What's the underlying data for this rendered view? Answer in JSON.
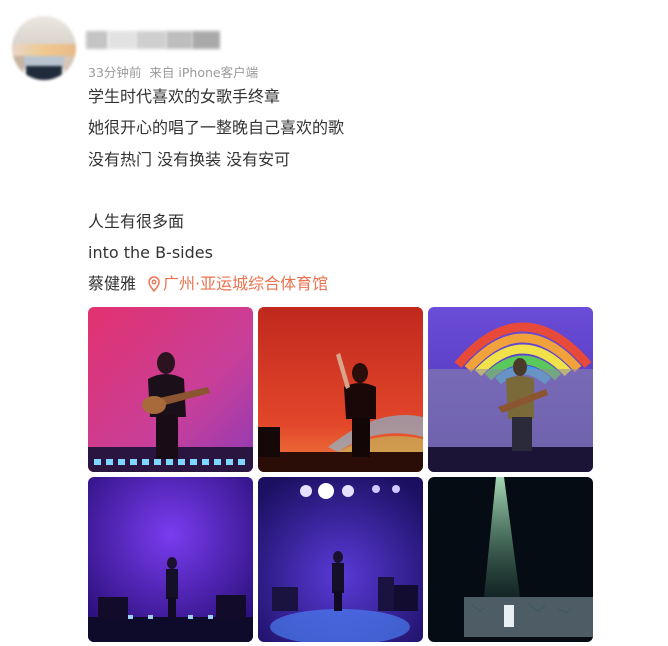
{
  "post": {
    "time": "33分钟前",
    "source": "来自 iPhone客户端",
    "lines": [
      "学生时代喜欢的女歌手终章",
      "她很开心的唱了一整晚自己喜欢的歌",
      "没有热门 没有换装 没有安可",
      "人生有很多面",
      "into the B-sides"
    ],
    "artist": "蔡健雅",
    "location": "广州·亚运城综合体育馆"
  },
  "icons": {
    "location": "location-pin-icon"
  },
  "colors": {
    "location": "#eb7350",
    "meta": "#9a9a9a"
  },
  "photos": [
    {
      "name": "photo-1"
    },
    {
      "name": "photo-2"
    },
    {
      "name": "photo-3"
    },
    {
      "name": "photo-4"
    },
    {
      "name": "photo-5"
    },
    {
      "name": "photo-6"
    }
  ]
}
